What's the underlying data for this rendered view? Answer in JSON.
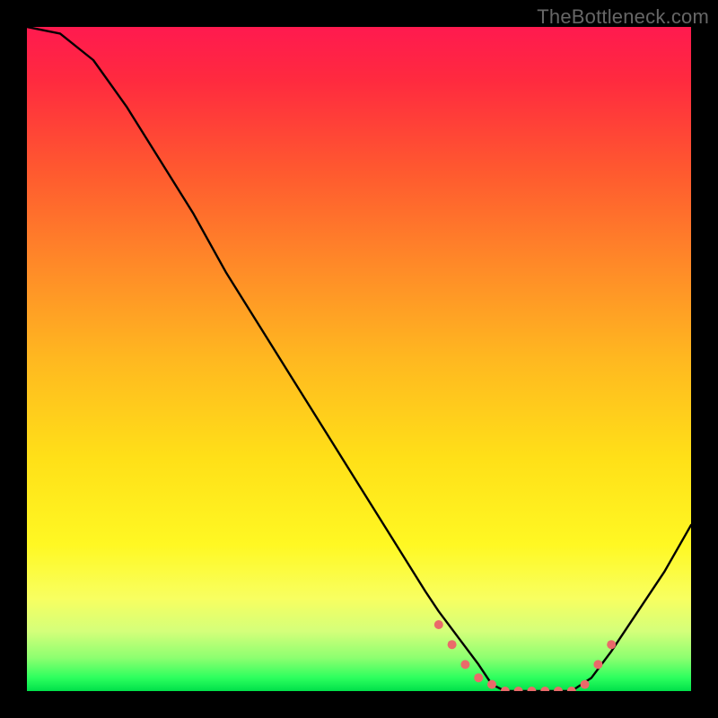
{
  "attribution": "TheBottleneck.com",
  "chart_data": {
    "type": "line",
    "title": "",
    "xlabel": "",
    "ylabel": "",
    "xlim": [
      0,
      100
    ],
    "ylim": [
      0,
      100
    ],
    "series": [
      {
        "name": "bottleneck-curve",
        "x": [
          0,
          5,
          10,
          15,
          20,
          25,
          30,
          35,
          40,
          45,
          50,
          55,
          60,
          62,
          65,
          68,
          70,
          72,
          74,
          76,
          78,
          80,
          82,
          85,
          88,
          92,
          96,
          100
        ],
        "values": [
          100,
          99,
          95,
          88,
          80,
          72,
          63,
          55,
          47,
          39,
          31,
          23,
          15,
          12,
          8,
          4,
          1,
          0,
          0,
          0,
          0,
          0,
          0,
          2,
          6,
          12,
          18,
          25
        ]
      }
    ],
    "markers": {
      "name": "flat-region-dots",
      "x": [
        62,
        64,
        66,
        68,
        70,
        72,
        74,
        76,
        78,
        80,
        82,
        84,
        86,
        88
      ],
      "values": [
        10,
        7,
        4,
        2,
        1,
        0,
        0,
        0,
        0,
        0,
        0,
        1,
        4,
        7
      ]
    },
    "gradient_bands": [
      {
        "pos": 0,
        "color": "#ff1a4f"
      },
      {
        "pos": 8,
        "color": "#ff2a3f"
      },
      {
        "pos": 22,
        "color": "#ff5a2f"
      },
      {
        "pos": 36,
        "color": "#ff8a28"
      },
      {
        "pos": 50,
        "color": "#ffb820"
      },
      {
        "pos": 65,
        "color": "#ffe018"
      },
      {
        "pos": 78,
        "color": "#fff823"
      },
      {
        "pos": 86,
        "color": "#f8ff60"
      },
      {
        "pos": 91,
        "color": "#d4ff7a"
      },
      {
        "pos": 95,
        "color": "#8dff70"
      },
      {
        "pos": 98,
        "color": "#2dff5e"
      },
      {
        "pos": 100,
        "color": "#00e04a"
      }
    ]
  }
}
